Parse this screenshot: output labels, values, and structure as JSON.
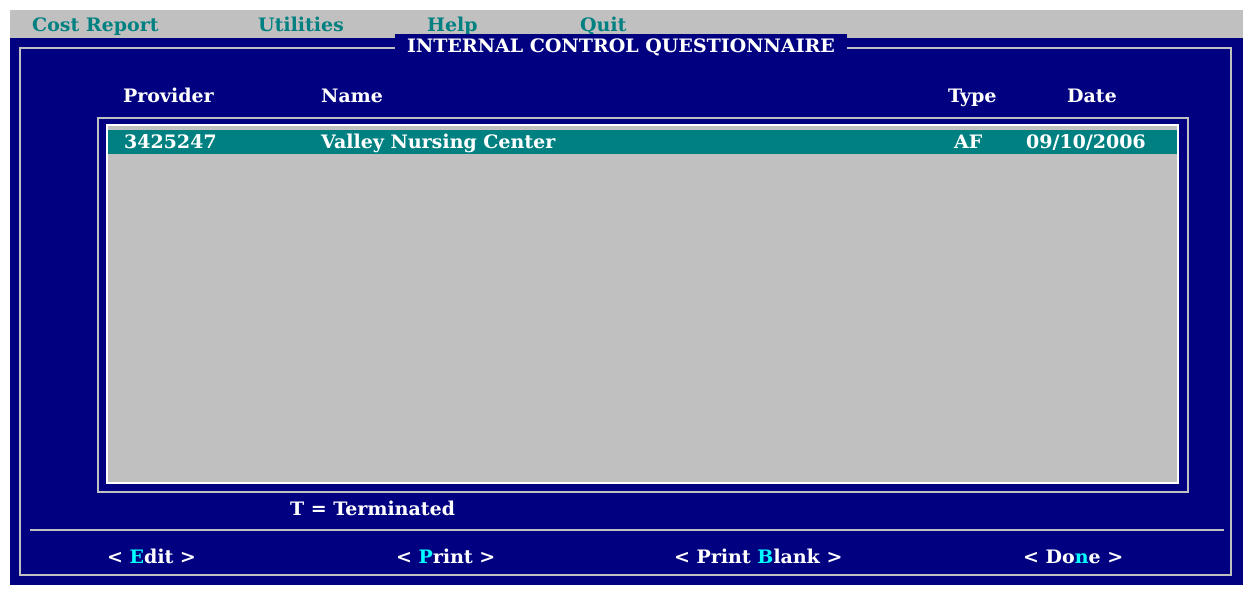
{
  "menu": {
    "cost_report": "Cost Report",
    "utilities": "Utilities",
    "help": "Help",
    "quit": "Quit"
  },
  "window": {
    "title": "INTERNAL CONTROL QUESTIONNAIRE"
  },
  "columns": {
    "provider": "Provider",
    "name": "Name",
    "type": "Type",
    "date": "Date"
  },
  "rows": [
    {
      "provider": "3425247",
      "name": "Valley Nursing Center",
      "type": "AF",
      "date": "09/10/2006",
      "selected": true
    }
  ],
  "legend": "T = Terminated",
  "buttons": {
    "edit": {
      "pre": "< ",
      "hot": "E",
      "post": "dit >"
    },
    "print": {
      "pre": "< ",
      "hot": "P",
      "post": "rint >"
    },
    "print_blank": {
      "pre": "< Print ",
      "hot": "B",
      "post": "lank >"
    },
    "done": {
      "pre": "< Do",
      "hot": "n",
      "post": "e >"
    }
  },
  "colors": {
    "background": "#000080",
    "menubar": "#c0c0c0",
    "menu_text": "#008080",
    "selection": "#008080",
    "hotkey": "#00ffff",
    "list": "#c0c0c0"
  }
}
